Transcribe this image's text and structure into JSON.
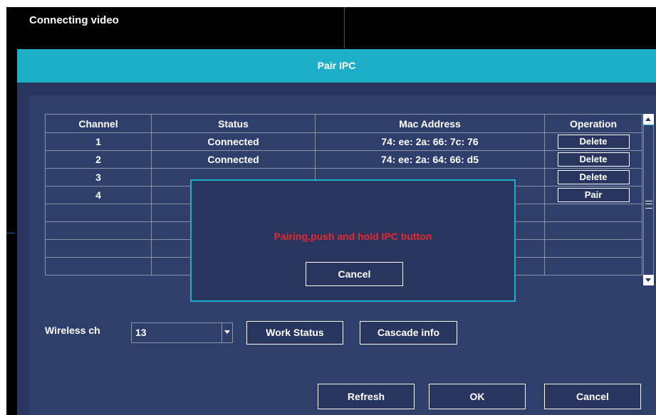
{
  "top": {
    "status": "Connecting video"
  },
  "dialog": {
    "title": "Pair IPC",
    "table": {
      "headers": [
        "Channel",
        "Status",
        "Mac Address",
        "Operation"
      ],
      "rows": [
        {
          "channel": "1",
          "status": "Connected",
          "mac": "74: ee: 2a: 66: 7c: 76",
          "op": "Delete"
        },
        {
          "channel": "2",
          "status": "Connected",
          "mac": "74: ee: 2a: 64: 66: d5",
          "op": "Delete"
        },
        {
          "channel": "3",
          "status": "",
          "mac": "",
          "op": "Delete"
        },
        {
          "channel": "4",
          "status": "",
          "mac": "",
          "op": "Pair"
        },
        {
          "channel": "",
          "status": "",
          "mac": "",
          "op": ""
        },
        {
          "channel": "",
          "status": "",
          "mac": "",
          "op": ""
        },
        {
          "channel": "",
          "status": "",
          "mac": "",
          "op": ""
        },
        {
          "channel": "",
          "status": "",
          "mac": "",
          "op": ""
        }
      ]
    },
    "wireless": {
      "label": "Wireless ch",
      "value": "13"
    },
    "buttons": {
      "work_status": "Work Status",
      "cascade_info": "Cascade info",
      "refresh": "Refresh",
      "ok": "OK",
      "cancel": "Cancel"
    }
  },
  "popup": {
    "message": "Pairing,push and hold IPC button",
    "cancel": "Cancel",
    "message_color": "#e8282a"
  },
  "colors": {
    "accent": "#1daec8",
    "panel": "#27355f",
    "background": "#000000"
  },
  "icons": [
    "scroll-up-icon",
    "scroll-down-icon",
    "scroll-grip-icon",
    "dropdown-arrow-icon"
  ]
}
